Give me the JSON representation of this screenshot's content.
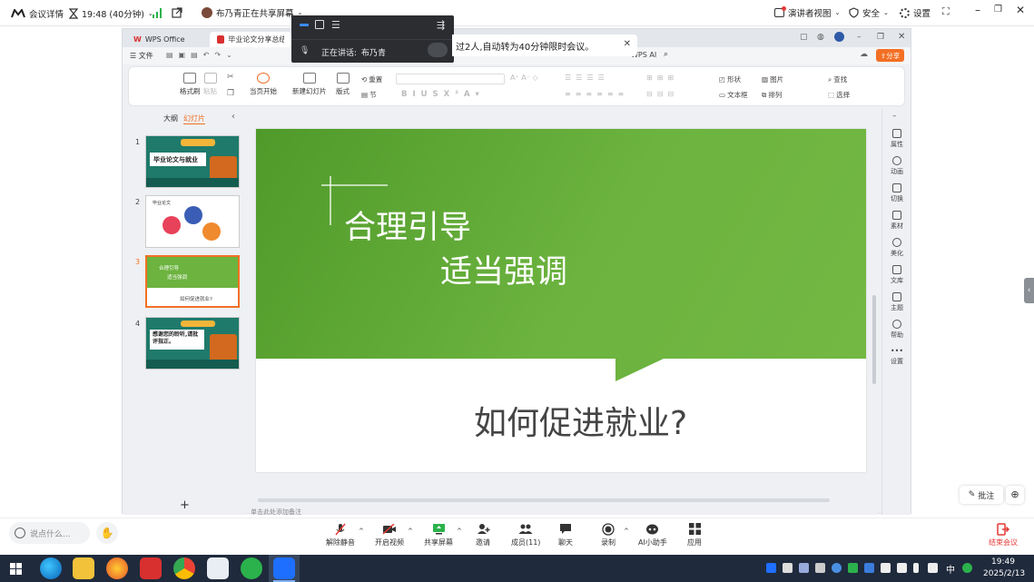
{
  "topbar": {
    "meeting_details": "会议详情",
    "time_remaining": "19:48 (40分钟)",
    "sharer_status": "布乃青正在共享屏幕",
    "presenter_view": "演讲者视图",
    "security": "安全",
    "settings": "设置"
  },
  "wps": {
    "tabs": [
      {
        "label": "WPS Office"
      },
      {
        "label": "毕业论文分享总结.pptx"
      }
    ],
    "menu_file": "文件",
    "menu_wps_ai": "WPS AI",
    "share_label": "分享",
    "ribbon": {
      "format_painter": "格式刷",
      "paste": "粘贴",
      "play_current": "当页开始",
      "new_slide": "新建幻灯片",
      "layout": "版式",
      "reset": "重置",
      "section": "节",
      "shape": "形状",
      "picture": "图片",
      "find": "查找",
      "textbox": "文本框",
      "arrange": "排列",
      "select": "选择"
    },
    "panel_tabs": {
      "outline": "大纲",
      "slides": "幻灯片"
    },
    "slides": [
      {
        "num": "1",
        "title": "毕业论文与就业"
      },
      {
        "num": "2",
        "title": "毕业论文"
      },
      {
        "num": "3",
        "line1": "合理引导",
        "line2": "适当强调",
        "caption": "如何促进就业?"
      },
      {
        "num": "4",
        "title": "感谢您的聆听,请批评指正。"
      }
    ],
    "add_slide": "+",
    "notes_placeholder": "单击此处添加备注",
    "main_slide": {
      "heading1": "合理引导",
      "heading2": "适当强调",
      "question": "如何促进就业?"
    },
    "right_panel": [
      "属性",
      "动画",
      "切换",
      "素材",
      "美化",
      "文库",
      "主题",
      "帮助",
      "设置"
    ],
    "annotate_button": "批注"
  },
  "meeting_overlay": {
    "speaking_label": "正在讲话:",
    "speaker": "布乃青"
  },
  "notice": {
    "text": "过2人,自动转为40分钟限时会议。"
  },
  "bottombar": {
    "chat_placeholder": "说点什么...",
    "buttons": [
      {
        "label": "解除静音"
      },
      {
        "label": "开启视频"
      },
      {
        "label": "共享屏幕"
      },
      {
        "label": "邀请"
      },
      {
        "label": "成员(11)"
      },
      {
        "label": "聊天"
      },
      {
        "label": "录制"
      },
      {
        "label": "AI小助手"
      },
      {
        "label": "应用"
      }
    ],
    "end_meeting": "结束会议"
  },
  "taskbar": {
    "ime": "中",
    "time": "19:49",
    "date": "2025/2/13"
  },
  "colors": {
    "slide_green": "#6cb33f",
    "end_red": "#e53935",
    "accent_orange": "#f36f24",
    "wps_red": "#d8302f"
  }
}
